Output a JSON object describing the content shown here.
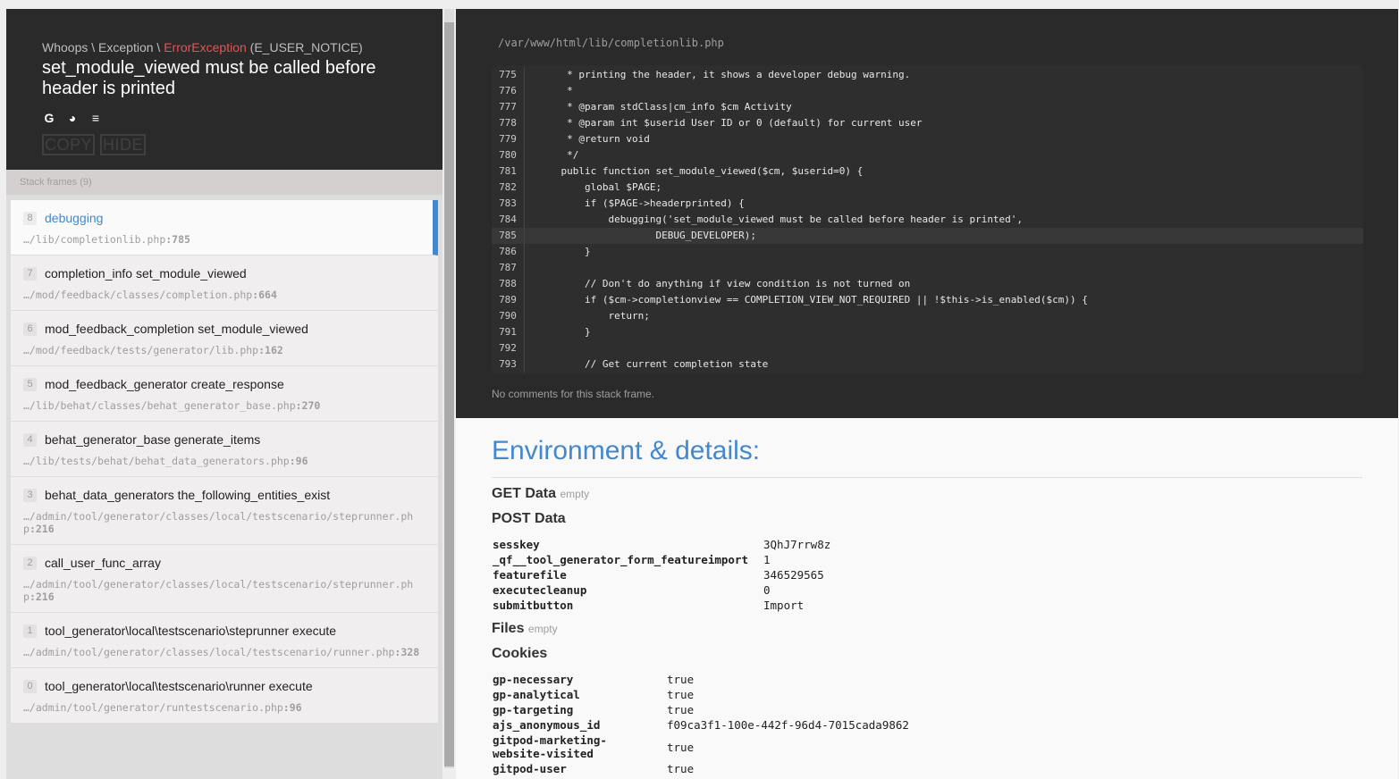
{
  "header": {
    "exception_prefix": "Whoops \\ Exception \\ ",
    "exception_class": "ErrorException",
    "exception_code": " (E_USER_NOTICE)",
    "message": "set_module_viewed must be called before header is printed",
    "search_icons": [
      "google-icon",
      "duckduckgo-icon",
      "stackoverflow-icon"
    ],
    "copy_label": "COPY",
    "hide_label": "HIDE"
  },
  "frames_label": "Stack frames (9)",
  "frames": [
    {
      "index": "8",
      "name": "debugging",
      "path": "…/lib/completionlib.php",
      "line": ":785"
    },
    {
      "index": "7",
      "name": "completion_info set_module_viewed",
      "path": "…/mod/feedback/classes/completion.php",
      "line": ":664"
    },
    {
      "index": "6",
      "name": "mod_feedback_completion set_module_viewed",
      "path": "…/mod/feedback/tests/generator/lib.php",
      "line": ":162"
    },
    {
      "index": "5",
      "name": "mod_feedback_generator create_response",
      "path": "…/lib/behat/classes/behat_generator_base.php",
      "line": ":270"
    },
    {
      "index": "4",
      "name": "behat_generator_base generate_items",
      "path": "…/lib/tests/behat/behat_data_generators.php",
      "line": ":96"
    },
    {
      "index": "3",
      "name": "behat_data_generators the_following_entities_exist",
      "path": "…/admin/tool/generator/classes/local/testscenario/steprunner.php",
      "line": ":216"
    },
    {
      "index": "2",
      "name": "call_user_func_array",
      "path": "…/admin/tool/generator/classes/local/testscenario/steprunner.php",
      "line": ":216"
    },
    {
      "index": "1",
      "name": "tool_generator\\local\\testscenario\\steprunner execute",
      "path": "…/admin/tool/generator/classes/local/testscenario/runner.php",
      "line": ":328"
    },
    {
      "index": "0",
      "name": "tool_generator\\local\\testscenario\\runner execute",
      "path": "…/admin/tool/generator/runtestscenario.php",
      "line": ":96"
    }
  ],
  "code": {
    "file_path": "/var/www/html/lib/completionlib.php",
    "lines": [
      {
        "n": "775",
        "t": "     * printing the header, it shows a developer debug warning."
      },
      {
        "n": "776",
        "t": "     *"
      },
      {
        "n": "777",
        "t": "     * @param stdClass|cm_info $cm Activity"
      },
      {
        "n": "778",
        "t": "     * @param int $userid User ID or 0 (default) for current user"
      },
      {
        "n": "779",
        "t": "     * @return void"
      },
      {
        "n": "780",
        "t": "     */"
      },
      {
        "n": "781",
        "t": "    public function set_module_viewed($cm, $userid=0) {"
      },
      {
        "n": "782",
        "t": "        global $PAGE;"
      },
      {
        "n": "783",
        "t": "        if ($PAGE->headerprinted) {"
      },
      {
        "n": "784",
        "t": "            debugging('set_module_viewed must be called before header is printed',"
      },
      {
        "n": "785",
        "t": "                    DEBUG_DEVELOPER);"
      },
      {
        "n": "786",
        "t": "        }"
      },
      {
        "n": "787",
        "t": ""
      },
      {
        "n": "788",
        "t": "        // Don't do anything if view condition is not turned on"
      },
      {
        "n": "789",
        "t": "        if ($cm->completionview == COMPLETION_VIEW_NOT_REQUIRED || !$this->is_enabled($cm)) {"
      },
      {
        "n": "790",
        "t": "            return;"
      },
      {
        "n": "791",
        "t": "        }"
      },
      {
        "n": "792",
        "t": ""
      },
      {
        "n": "793",
        "t": "        // Get current completion state"
      }
    ],
    "no_comments": "No comments for this stack frame."
  },
  "details": {
    "title": "Environment & details:",
    "get_label": "GET Data",
    "get_empty": "empty",
    "post_label": "POST Data",
    "post": [
      {
        "k": "sesskey",
        "v": "3QhJ7rrw8z"
      },
      {
        "k": "_qf__tool_generator_form_featureimport",
        "v": "1"
      },
      {
        "k": "featurefile",
        "v": "346529565"
      },
      {
        "k": "executecleanup",
        "v": "0"
      },
      {
        "k": "submitbutton",
        "v": "Import"
      }
    ],
    "files_label": "Files",
    "files_empty": "empty",
    "cookies_label": "Cookies",
    "cookies": [
      {
        "k": "gp-necessary",
        "v": "true"
      },
      {
        "k": "gp-analytical",
        "v": "true"
      },
      {
        "k": "gp-targeting",
        "v": "true"
      },
      {
        "k": "ajs_anonymous_id",
        "v": "f09ca3f1-100e-442f-96d4-7015cada9862"
      },
      {
        "k": "gitpod-marketing-website-visited",
        "v": "true"
      },
      {
        "k": "gitpod-user",
        "v": "true"
      }
    ]
  }
}
